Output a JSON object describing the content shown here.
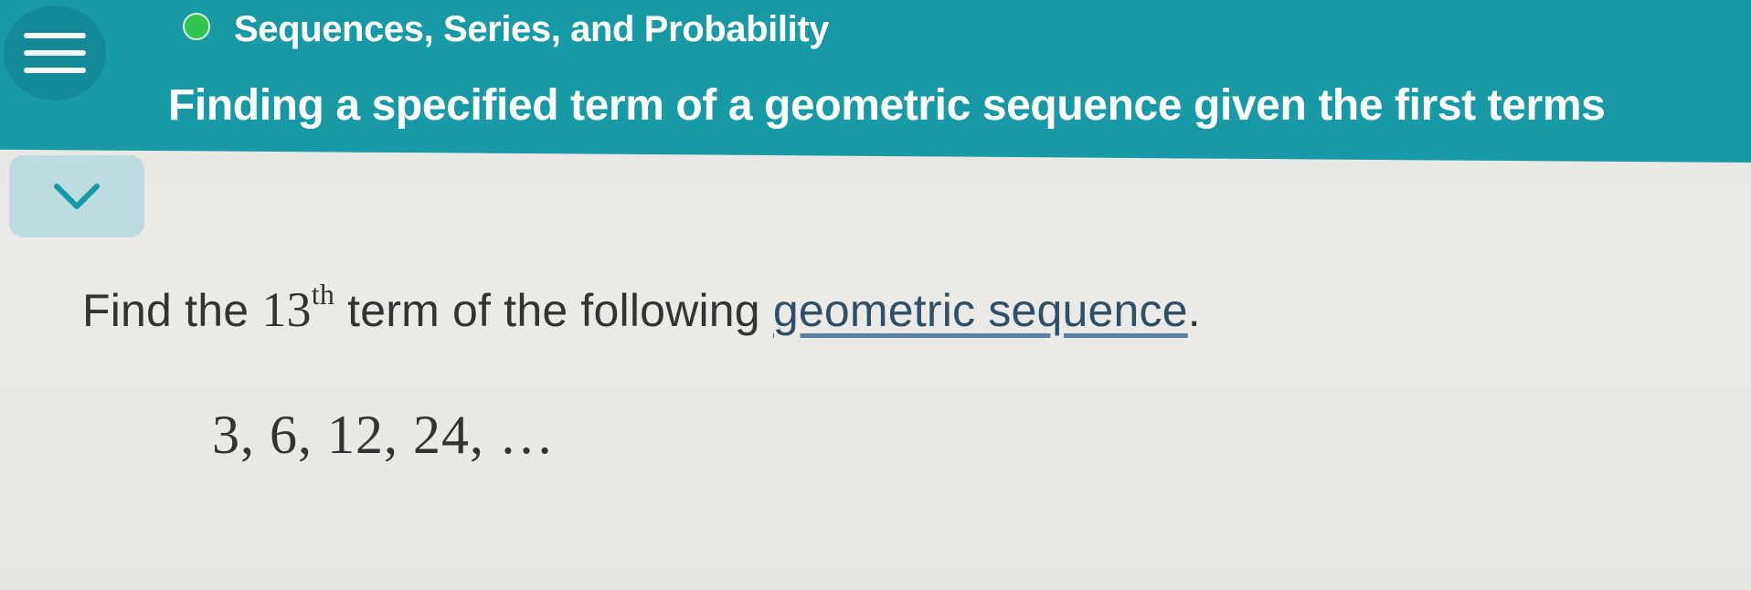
{
  "header": {
    "menu_icon": "hamburger-menu-icon",
    "status_icon": "green-dot-icon",
    "status_color": "#2fc54f",
    "accent_color": "#1799a6",
    "topic": "Sequences, Series, and Probability",
    "title": "Finding a specified term of a geometric sequence given the first terms"
  },
  "collapse": {
    "icon": "chevron-down-icon"
  },
  "question": {
    "prefix": "Find the",
    "term_number": "13",
    "term_suffix": "th",
    "middle": "term of the following",
    "link_text": "geometric sequence",
    "end": "."
  },
  "sequence": {
    "text": "3, 6, 12, 24, …"
  }
}
